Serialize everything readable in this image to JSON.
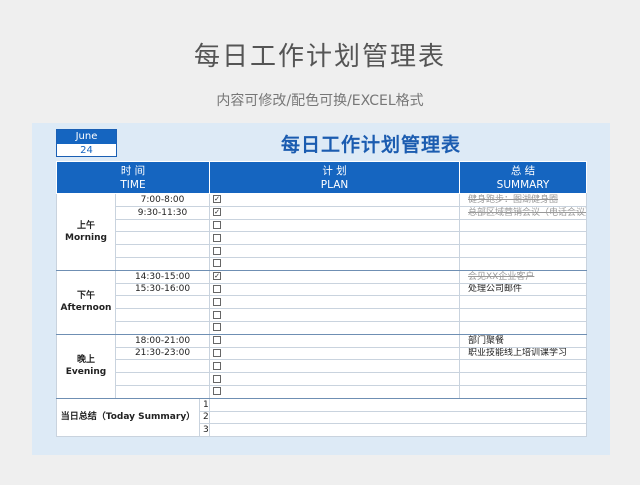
{
  "header": {
    "title": "每日工作计划管理表",
    "subtitle": "内容可修改/配色可换/EXCEL格式"
  },
  "sheet": {
    "date": {
      "month": "June",
      "day": "24"
    },
    "title": "每日工作计划管理表",
    "columns": {
      "time": {
        "cn": "时 间",
        "en": "TIME"
      },
      "plan": {
        "cn": "计 划",
        "en": "PLAN"
      },
      "summary": {
        "cn": "总 结",
        "en": "SUMMARY"
      }
    },
    "periods": [
      {
        "cn": "上午",
        "en": "Morning",
        "rows": [
          {
            "time": "7:00-8:00",
            "checked": true,
            "plan": "健身跑步：图湖健身圈",
            "done": true
          },
          {
            "time": "9:30-11:30",
            "checked": true,
            "plan": "总部区域营销会议（电话会议）",
            "done": true
          },
          {
            "time": "",
            "checked": false,
            "plan": "",
            "done": false
          },
          {
            "time": "",
            "checked": false,
            "plan": "",
            "done": false
          },
          {
            "time": "",
            "checked": false,
            "plan": "",
            "done": false
          },
          {
            "time": "",
            "checked": false,
            "plan": "",
            "done": false
          }
        ]
      },
      {
        "cn": "下午",
        "en": "Afternoon",
        "rows": [
          {
            "time": "14:30-15:00",
            "checked": true,
            "plan": "会见XX企业客户",
            "done": true
          },
          {
            "time": "15:30-16:00",
            "checked": false,
            "plan": "处理公司邮件",
            "done": false
          },
          {
            "time": "",
            "checked": false,
            "plan": "",
            "done": false
          },
          {
            "time": "",
            "checked": false,
            "plan": "",
            "done": false
          },
          {
            "time": "",
            "checked": false,
            "plan": "",
            "done": false
          }
        ]
      },
      {
        "cn": "晚上",
        "en": "Evening",
        "rows": [
          {
            "time": "18:00-21:00",
            "checked": false,
            "plan": "部门聚餐",
            "done": false
          },
          {
            "time": "21:30-23:00",
            "checked": false,
            "plan": "职业技能线上培训课学习",
            "done": false
          },
          {
            "time": "",
            "checked": false,
            "plan": "",
            "done": false
          },
          {
            "time": "",
            "checked": false,
            "plan": "",
            "done": false
          },
          {
            "time": "",
            "checked": false,
            "plan": "",
            "done": false
          }
        ]
      }
    ],
    "summary_label": "当日总结（Today Summary）",
    "summary_items": [
      "1",
      "2",
      "3"
    ]
  },
  "colors": {
    "accent": "#1565c0",
    "sheet_bg": "#ddeaf6",
    "page_bg": "#efefef"
  }
}
